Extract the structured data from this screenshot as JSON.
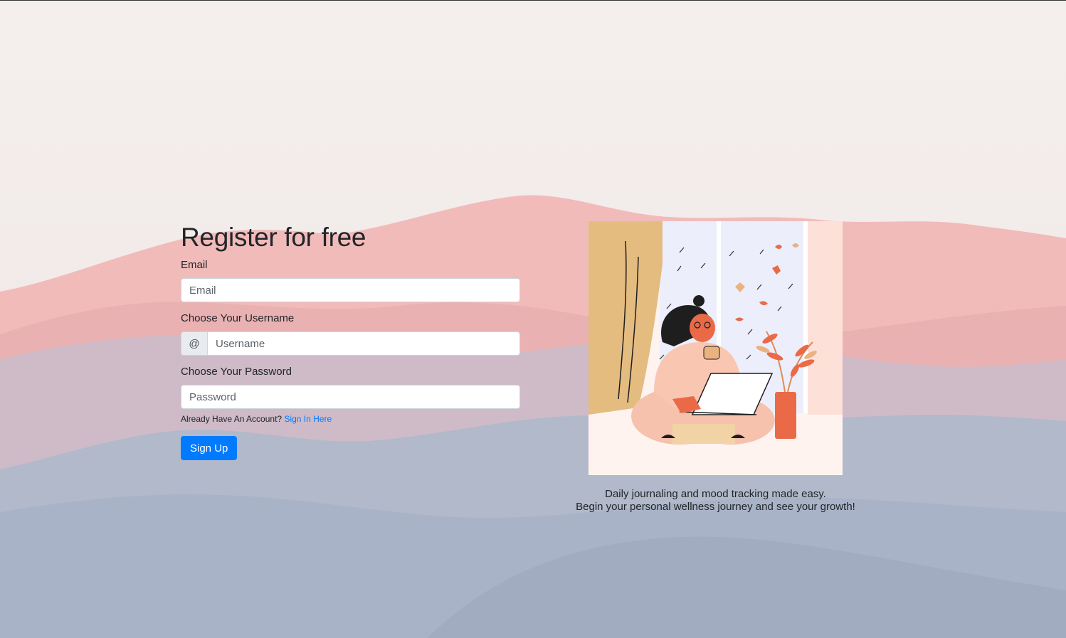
{
  "form": {
    "title": "Register for free",
    "email_label": "Email",
    "email_placeholder": "Email",
    "username_label": "Choose Your Username",
    "username_prefix": "@",
    "username_placeholder": "Username",
    "password_label": "Choose Your Password",
    "password_placeholder": "Password",
    "account_prompt": "Already Have An Account?",
    "signin_link": "Sign In Here",
    "submit_label": "Sign Up"
  },
  "hero": {
    "caption_line1": "Daily journaling and mood tracking made easy.",
    "caption_line2": "Begin your personal wellness journey and see your growth!"
  },
  "colors": {
    "primary": "#007bff",
    "mountain_pink": "#f2a9a8",
    "mountain_blue": "#a9b4c7"
  }
}
